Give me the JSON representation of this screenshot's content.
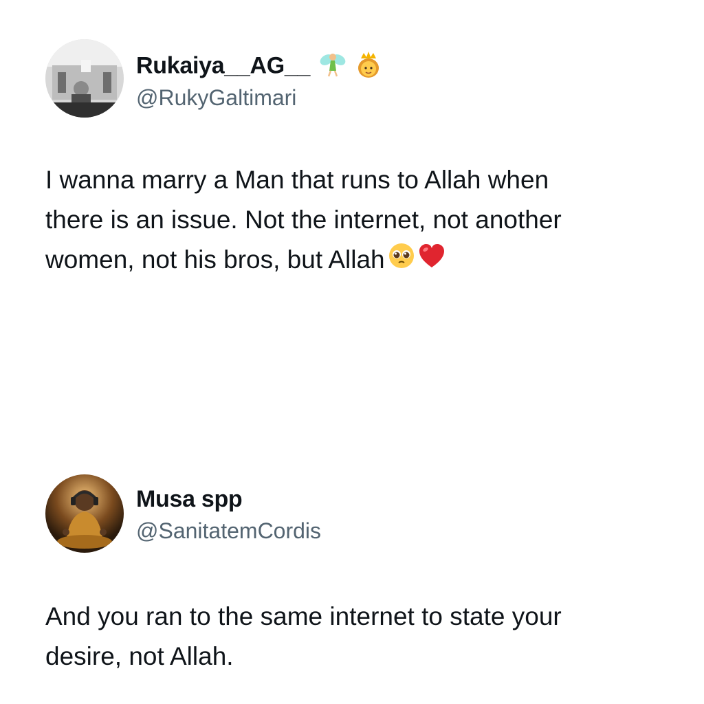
{
  "tweets": [
    {
      "display_name": "Rukaiya__AG__",
      "name_emojis": [
        "fairy-emoji",
        "princess-emoji"
      ],
      "handle": "@RukyGaltimari",
      "text_lines": [
        "I wanna marry a Man that runs to Allah when",
        "there is an issue. Not the internet, not another",
        "women, not his bros, but Allah"
      ],
      "text_emojis": [
        "pleading-face-emoji",
        "red-heart-emoji"
      ]
    },
    {
      "display_name": "Musa spp",
      "handle": "@SanitatemCordis",
      "text_lines": [
        "And you ran to the same internet to state your",
        "desire, not Allah."
      ]
    }
  ],
  "colors": {
    "text": "#0f1419",
    "handle": "#536471",
    "background": "#ffffff",
    "heart": "#e0252f"
  }
}
